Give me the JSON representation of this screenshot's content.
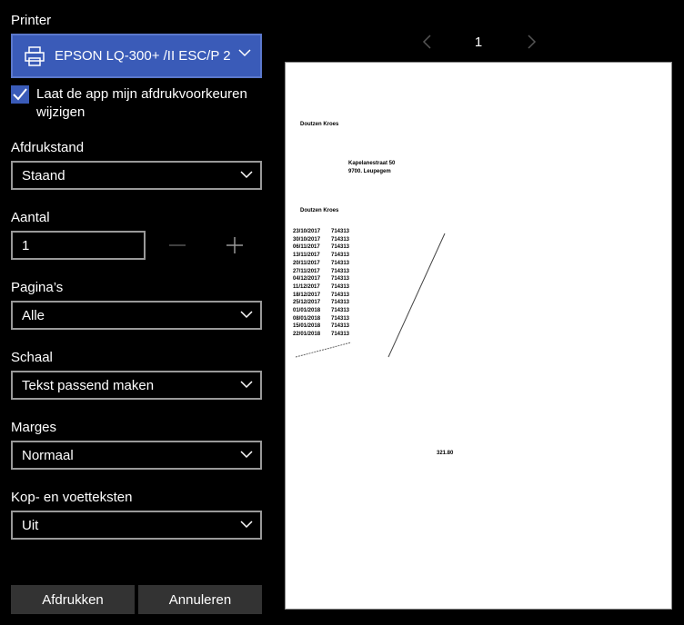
{
  "printer": {
    "label": "Printer",
    "name": "EPSON LQ-300+ /II ESC/P 2",
    "icon": "printer-icon",
    "allow_app_label": "Laat de app mijn afdrukvoorkeuren wijzigen",
    "allow_app_checked": true
  },
  "orientation": {
    "label": "Afdrukstand",
    "value": "Staand"
  },
  "copies": {
    "label": "Aantal",
    "value": "1",
    "decrement": "−",
    "increment": "+"
  },
  "pages": {
    "label": "Pagina’s",
    "value": "Alle"
  },
  "scale": {
    "label": "Schaal",
    "value": "Tekst passend maken"
  },
  "margins": {
    "label": "Marges",
    "value": "Normaal"
  },
  "headers": {
    "label": "Kop- en voetteksten",
    "value": "Uit"
  },
  "buttons": {
    "print": "Afdrukken",
    "cancel": "Annuleren"
  },
  "preview": {
    "page": "1",
    "sender": "Doutzen Kroes",
    "address_line1": "Kapelanestraat 50",
    "address_line2": "9700. Leupegem",
    "name2": "Doutzen Kroes",
    "rows": [
      {
        "date": "23/10/2017",
        "code": "714313"
      },
      {
        "date": "30/10/2017",
        "code": "714313"
      },
      {
        "date": "06/11/2017",
        "code": "714313"
      },
      {
        "date": "13/11/2017",
        "code": "714313"
      },
      {
        "date": "20/11/2017",
        "code": "714313"
      },
      {
        "date": "27/11/2017",
        "code": "714313"
      },
      {
        "date": "04/12/2017",
        "code": "714313"
      },
      {
        "date": "11/12/2017",
        "code": "714313"
      },
      {
        "date": "18/12/2017",
        "code": "714313"
      },
      {
        "date": "25/12/2017",
        "code": "714313"
      },
      {
        "date": "01/01/2018",
        "code": "714313"
      },
      {
        "date": "08/01/2018",
        "code": "714313"
      },
      {
        "date": "15/01/2018",
        "code": "714313"
      },
      {
        "date": "22/01/2018",
        "code": "714313"
      }
    ],
    "total": "321.80"
  },
  "colors": {
    "accent": "#3a5bb8",
    "background": "#000000",
    "border": "#999999",
    "button": "#333333"
  }
}
